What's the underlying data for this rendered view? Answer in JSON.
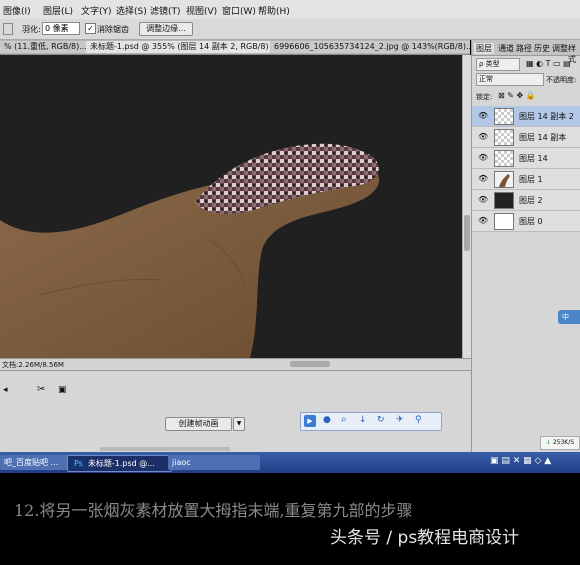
{
  "menu": {
    "items": [
      "图像(I)",
      "图层(L)",
      "文字(Y)",
      "选择(S)",
      "滤镜(T)",
      "视图(V)",
      "窗口(W)",
      "帮助(H)"
    ]
  },
  "options": {
    "feather_label": "羽化:",
    "feather_value": "0 像素",
    "antialias_label": "消除锯齿",
    "refine_edge_button": "调整边缘..."
  },
  "tabs": [
    {
      "label": "% (11.重低, RGB/8)..."
    },
    {
      "label": "未标题-1.psd @ 355% (图层 14 副本 2, RGB/8) *"
    },
    {
      "label": "6996606_105635734124_2.jpg @ 143%(RGB/8)..."
    }
  ],
  "status": {
    "doc_size": "文档:2.26M/8.56M"
  },
  "animation": {
    "create_button": "创建帧动画",
    "dropdown_arrow": "▼"
  },
  "layers_panel": {
    "tabs": [
      "图层",
      "通道",
      "路径",
      "历史",
      "调整",
      "样式"
    ],
    "kind_label": "ρ 类型",
    "blend_mode": "正常",
    "opacity_label": "不透明度:",
    "lock_label": "锁定:",
    "layers": [
      {
        "name": "图层 14 副本 2",
        "selected": true,
        "thumb": "checker"
      },
      {
        "name": "图层 14 副本",
        "selected": false,
        "thumb": "checker"
      },
      {
        "name": "图层 14",
        "selected": false,
        "thumb": "checker"
      },
      {
        "name": "图层 1",
        "selected": false,
        "thumb": "hand"
      },
      {
        "name": "图层 2",
        "selected": false,
        "thumb": "dark"
      },
      {
        "name": "图层 0",
        "selected": false,
        "thumb": "white"
      }
    ]
  },
  "side_widget": {
    "label": "中"
  },
  "speed_widget": {
    "label": "253K/S"
  },
  "taskbar": {
    "items": [
      "吧_百度贴吧 ...",
      "未标题-1.psd @...",
      "jiaoc"
    ]
  },
  "caption": {
    "step_text": "12.将另一张烟灰素材放置大拇指末端,重复第九部的步骤",
    "watermark": "头条号 / ps教程电商设计"
  },
  "colors": {
    "canvas_bg": "#202020",
    "panel_bg": "#d6d6d6",
    "selection_blue": "#b3c8e6",
    "taskbar_blue": "#2a4c96",
    "caption_text": "#8a8a8a"
  }
}
